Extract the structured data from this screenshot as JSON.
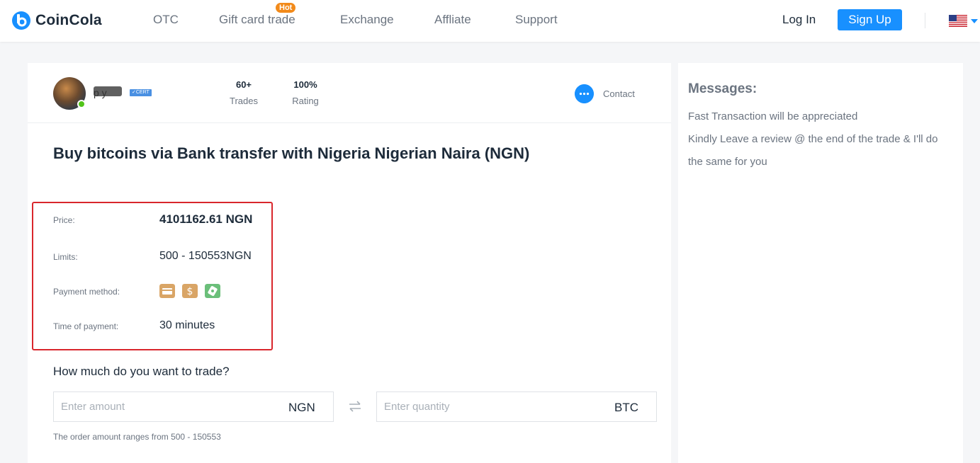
{
  "brand": {
    "name": "CoinCola",
    "accent": "#1890ff",
    "hot_color": "#f28a1a",
    "highlight_color": "#d9262c"
  },
  "nav": {
    "items": [
      {
        "label": "OTC"
      },
      {
        "label": "Gift card trade",
        "badge": "Hot"
      },
      {
        "label": "Exchange"
      },
      {
        "label": "Affliate"
      },
      {
        "label": "Support"
      }
    ],
    "login_label": "Log In",
    "signup_label": "Sign Up",
    "language_icon": "us-flag-icon"
  },
  "trader": {
    "username": "p y",
    "cert_badge": "CERT",
    "stats": [
      {
        "value": "60+",
        "label": "Trades"
      },
      {
        "value": "100%",
        "label": "Rating"
      }
    ],
    "contact_label": "Contact"
  },
  "offer": {
    "title": "Buy bitcoins via Bank transfer with Nigeria Nigerian Naira (NGN)",
    "price_label": "Price:",
    "price_value": "4101162.61 NGN",
    "limits_label": "Limits:",
    "limits_value": "500 - 150553NGN",
    "payment_method_label": "Payment method:",
    "payment_method_icons": [
      "bank-card-icon",
      "cash-dollar-icon",
      "mobile-money-icon"
    ],
    "time_label": "Time of payment:",
    "time_value": "30 minutes"
  },
  "trade_form": {
    "question": "How much do you want to trade?",
    "amount_placeholder": "Enter amount",
    "amount_currency": "NGN",
    "quantity_placeholder": "Enter quantity",
    "quantity_currency": "BTC",
    "range_note": "The order amount ranges from 500 - 150553"
  },
  "messages": {
    "title": "Messages:",
    "lines": [
      "Fast Transaction will be appreciated",
      "Kindly Leave a review @ the end of the trade & I'll do the same for you"
    ]
  }
}
